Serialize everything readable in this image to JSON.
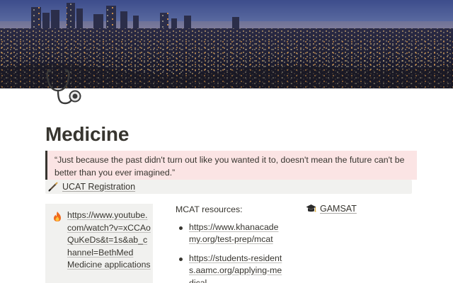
{
  "cover": {
    "alt_icon": "city-skyline-cover-image"
  },
  "page": {
    "icon": "stethoscope-icon",
    "title": "Medicine",
    "quote": "“Just because the past didn't turn out like you wanted it to, doesn't mean the future can't be better than you ever imagined.”"
  },
  "ucat": {
    "icon": "pen-icon",
    "label": "UCAT Registration"
  },
  "column1": {
    "icon": "fire-icon",
    "link": "https://www.youtube.com/watch?v=xCCAoQuKeDs&t=1s&ab_channel=BethMed",
    "link2": "Medicine applications"
  },
  "column2": {
    "heading": "MCAT resources:",
    "links": [
      "https://www.khanacademy.org/test-prep/mcat",
      "https://students-residents.aamc.org/applying-medical"
    ]
  },
  "column3": {
    "icon": "graduation-cap-icon",
    "label": "GAMSAT"
  },
  "colors": {
    "quote_bg": "#fbe4e4",
    "callout_bg": "#f1f1ef",
    "text": "#37352f"
  }
}
